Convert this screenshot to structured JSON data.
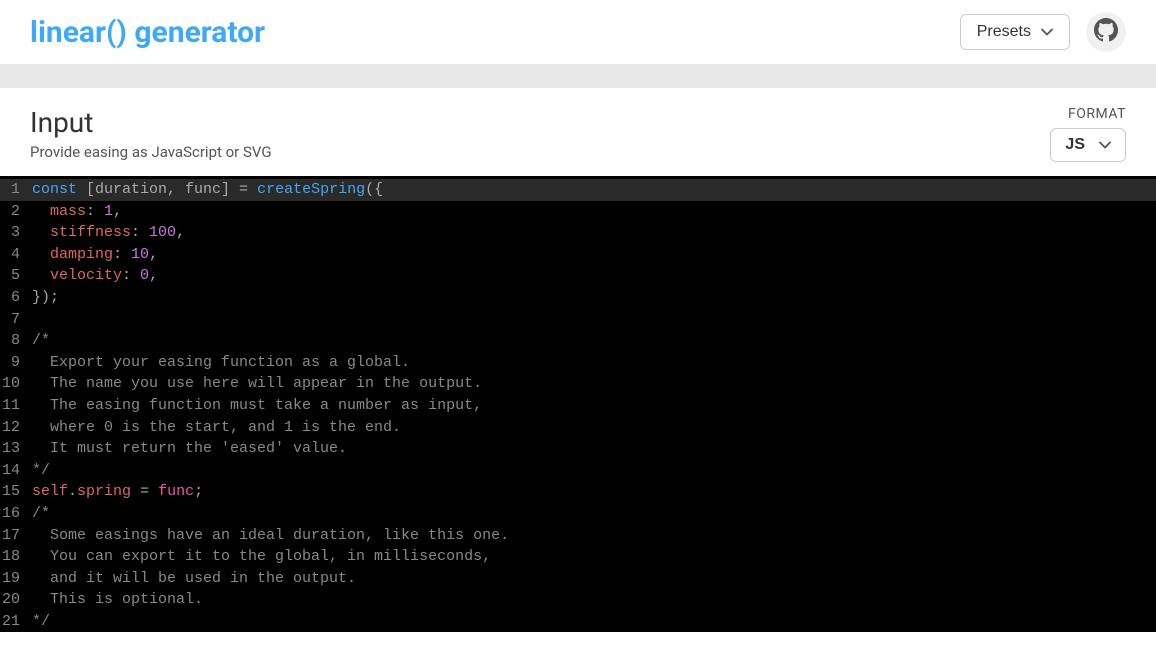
{
  "header": {
    "title": "linear() generator",
    "presets_label": "Presets"
  },
  "input_section": {
    "heading": "Input",
    "subheading": "Provide easing as JavaScript or SVG",
    "format_label": "FORMAT",
    "format_value": "JS"
  },
  "code_lines": [
    {
      "n": 1,
      "active": true,
      "tokens": [
        {
          "t": "const",
          "c": "tok-keyword"
        },
        {
          "t": " [duration, func] ",
          "c": "tok-brackets"
        },
        {
          "t": "=",
          "c": "tok-punct"
        },
        {
          "t": " ",
          "c": ""
        },
        {
          "t": "createSpring",
          "c": "tok-fn"
        },
        {
          "t": "({",
          "c": "tok-punct"
        }
      ]
    },
    {
      "n": 2,
      "tokens": [
        {
          "t": "  ",
          "c": ""
        },
        {
          "t": "mass",
          "c": "tok-prop"
        },
        {
          "t": ": ",
          "c": "tok-punct"
        },
        {
          "t": "1",
          "c": "tok-num"
        },
        {
          "t": ",",
          "c": "tok-punct"
        }
      ]
    },
    {
      "n": 3,
      "tokens": [
        {
          "t": "  ",
          "c": ""
        },
        {
          "t": "stiffness",
          "c": "tok-prop"
        },
        {
          "t": ": ",
          "c": "tok-punct"
        },
        {
          "t": "100",
          "c": "tok-num"
        },
        {
          "t": ",",
          "c": "tok-punct"
        }
      ]
    },
    {
      "n": 4,
      "tokens": [
        {
          "t": "  ",
          "c": ""
        },
        {
          "t": "damping",
          "c": "tok-prop"
        },
        {
          "t": ": ",
          "c": "tok-punct"
        },
        {
          "t": "10",
          "c": "tok-num"
        },
        {
          "t": ",",
          "c": "tok-punct"
        }
      ]
    },
    {
      "n": 5,
      "tokens": [
        {
          "t": "  ",
          "c": ""
        },
        {
          "t": "velocity",
          "c": "tok-prop"
        },
        {
          "t": ": ",
          "c": "tok-punct"
        },
        {
          "t": "0",
          "c": "tok-num"
        },
        {
          "t": ",",
          "c": "tok-punct"
        }
      ]
    },
    {
      "n": 6,
      "tokens": [
        {
          "t": "});",
          "c": "tok-punct"
        }
      ]
    },
    {
      "n": 7,
      "tokens": []
    },
    {
      "n": 8,
      "tokens": [
        {
          "t": "/*",
          "c": "tok-comment"
        }
      ]
    },
    {
      "n": 9,
      "tokens": [
        {
          "t": "  Export your easing function as a global.",
          "c": "tok-comment"
        }
      ]
    },
    {
      "n": 10,
      "tokens": [
        {
          "t": "  The name you use here will appear in the output.",
          "c": "tok-comment"
        }
      ]
    },
    {
      "n": 11,
      "tokens": [
        {
          "t": "  The easing function must take a number as input,",
          "c": "tok-comment"
        }
      ]
    },
    {
      "n": 12,
      "tokens": [
        {
          "t": "  where 0 is the start, and 1 is the end.",
          "c": "tok-comment"
        }
      ]
    },
    {
      "n": 13,
      "tokens": [
        {
          "t": "  It must return the 'eased' value.",
          "c": "tok-comment"
        }
      ]
    },
    {
      "n": 14,
      "tokens": [
        {
          "t": "*/",
          "c": "tok-comment"
        }
      ]
    },
    {
      "n": 15,
      "tokens": [
        {
          "t": "self",
          "c": "tok-self"
        },
        {
          "t": ".",
          "c": "tok-punct"
        },
        {
          "t": "spring",
          "c": "tok-member"
        },
        {
          "t": " ",
          "c": ""
        },
        {
          "t": "=",
          "c": "tok-eq"
        },
        {
          "t": " ",
          "c": ""
        },
        {
          "t": "func",
          "c": "tok-var"
        },
        {
          "t": ";",
          "c": "tok-punct"
        }
      ]
    },
    {
      "n": 16,
      "tokens": [
        {
          "t": "/*",
          "c": "tok-comment"
        }
      ]
    },
    {
      "n": 17,
      "tokens": [
        {
          "t": "  Some easings have an ideal duration, like this one.",
          "c": "tok-comment"
        }
      ]
    },
    {
      "n": 18,
      "tokens": [
        {
          "t": "  You can export it to the global, in milliseconds,",
          "c": "tok-comment"
        }
      ]
    },
    {
      "n": 19,
      "tokens": [
        {
          "t": "  and it will be used in the output.",
          "c": "tok-comment"
        }
      ]
    },
    {
      "n": 20,
      "tokens": [
        {
          "t": "  This is optional.",
          "c": "tok-comment"
        }
      ]
    },
    {
      "n": 21,
      "tokens": [
        {
          "t": "*/",
          "c": "tok-comment"
        }
      ]
    }
  ]
}
